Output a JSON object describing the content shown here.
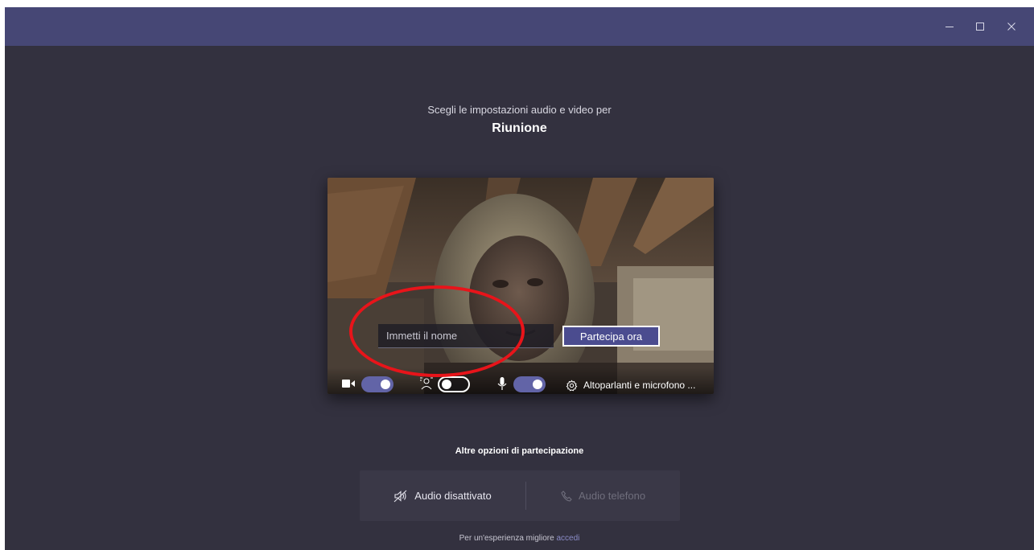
{
  "window": {
    "controls": [
      "minimize-icon",
      "maximize-icon",
      "close-icon"
    ]
  },
  "header": {
    "subtitle": "Scegli le impostazioni audio e video per",
    "meeting_title": "Riunione"
  },
  "preview": {
    "name_placeholder": "Immetti il nome",
    "join_label": "Partecipa ora",
    "camera_on": true,
    "background_blur_on": false,
    "mic_on": true,
    "device_settings_label": "Altoparlanti e microfono ..."
  },
  "other_options": {
    "title": "Altre opzioni di partecipazione",
    "audio_off_label": "Audio disattivato",
    "phone_audio_label": "Audio telefono"
  },
  "footer": {
    "text": "Per un'esperienza migliore",
    "link": "accedi"
  },
  "colors": {
    "titlebar": "#464775",
    "background": "#33313f",
    "accent": "#6264a7",
    "annotation": "#e8141a"
  }
}
